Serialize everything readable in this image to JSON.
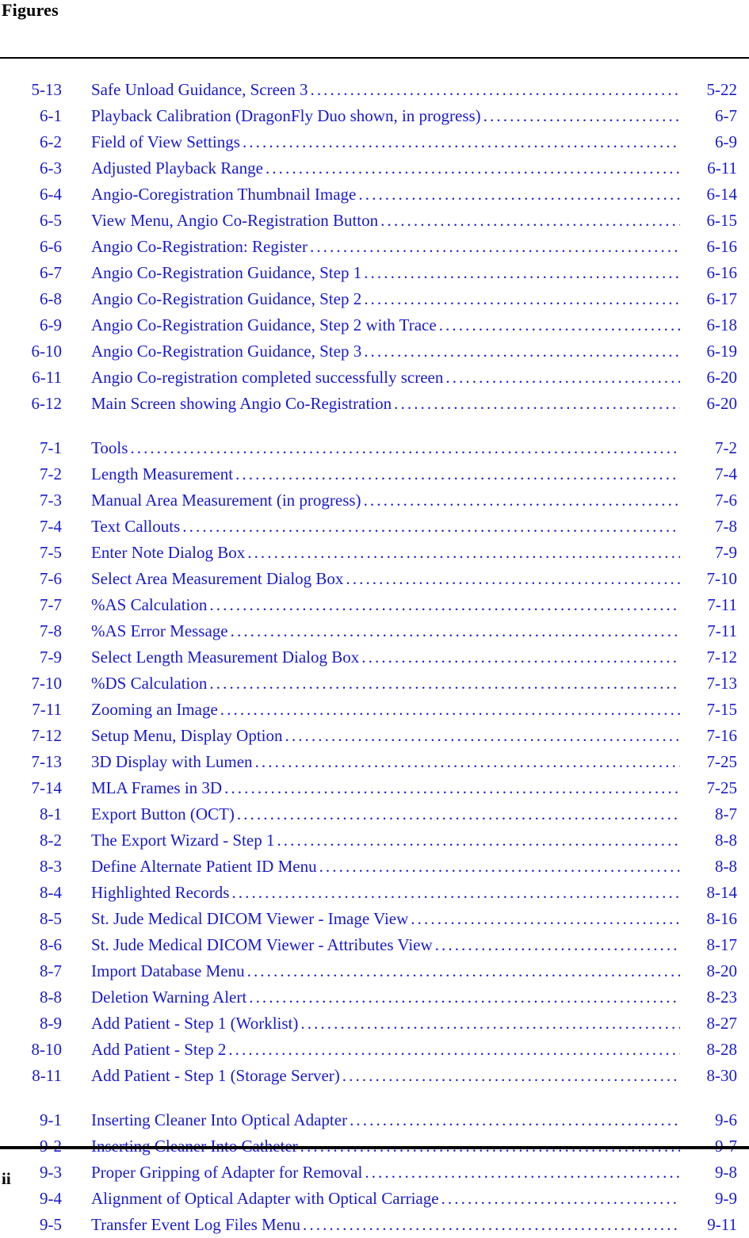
{
  "page": {
    "heading": "Figures",
    "footer_page_number": "ii",
    "text_color": "#1a1acc",
    "heading_color": "#000000",
    "leader_character": "."
  },
  "figure_groups": [
    {
      "group_id": "chapter-5-6",
      "spaced": false,
      "entries": [
        {
          "number": "5-13",
          "title": "Safe Unload Guidance, Screen 3",
          "page": "5-22"
        },
        {
          "number": "6-1",
          "title": "Playback Calibration (DragonFly Duo shown, in progress)",
          "page": "6-7"
        },
        {
          "number": "6-2",
          "title": "Field of View Settings",
          "page": "6-9"
        },
        {
          "number": "6-3",
          "title": "Adjusted Playback Range",
          "page": "6-11"
        },
        {
          "number": "6-4",
          "title": "Angio-Coregistration Thumbnail Image",
          "page": "6-14"
        },
        {
          "number": "6-5",
          "title": "View Menu, Angio Co-Registration Button",
          "page": "6-15"
        },
        {
          "number": "6-6",
          "title": "Angio Co-Registration: Register",
          "page": "6-16"
        },
        {
          "number": "6-7",
          "title": "Angio Co-Registration Guidance, Step 1",
          "page": "6-16"
        },
        {
          "number": "6-8",
          "title": "Angio Co-Registration Guidance, Step 2",
          "page": "6-17"
        },
        {
          "number": "6-9",
          "title": "Angio Co-Registration Guidance, Step 2 with Trace",
          "page": "6-18"
        },
        {
          "number": "6-10",
          "title": "Angio Co-Registration Guidance, Step 3",
          "page": "6-19"
        },
        {
          "number": "6-11",
          "title": "Angio Co-registration completed successfully screen",
          "page": "6-20"
        },
        {
          "number": "6-12",
          "title": "Main Screen showing Angio Co-Registration",
          "page": "6-20"
        }
      ]
    },
    {
      "group_id": "chapter-7-8",
      "spaced": true,
      "entries": [
        {
          "number": "7-1",
          "title": "Tools",
          "page": "7-2"
        },
        {
          "number": "7-2",
          "title": "Length Measurement",
          "page": "7-4"
        },
        {
          "number": "7-3",
          "title": "Manual Area Measurement (in progress)",
          "page": "7-6"
        },
        {
          "number": "7-4",
          "title": "Text Callouts",
          "page": "7-8"
        },
        {
          "number": "7-5",
          "title": "Enter Note Dialog Box",
          "page": "7-9"
        },
        {
          "number": "7-6",
          "title": "Select Area Measurement Dialog Box",
          "page": "7-10"
        },
        {
          "number": "7-7",
          "title": "%AS Calculation",
          "page": "7-11"
        },
        {
          "number": "7-8",
          "title": "%AS Error Message",
          "page": "7-11"
        },
        {
          "number": "7-9",
          "title": "Select Length Measurement Dialog Box",
          "page": "7-12"
        },
        {
          "number": "7-10",
          "title": "%DS Calculation",
          "page": "7-13"
        },
        {
          "number": "7-11",
          "title": "Zooming an Image",
          "page": "7-15"
        },
        {
          "number": "7-12",
          "title": "Setup Menu, Display Option",
          "page": "7-16"
        },
        {
          "number": "7-13",
          "title": "3D Display with Lumen",
          "page": "7-25"
        },
        {
          "number": "7-14",
          "title": "MLA Frames in 3D",
          "page": "7-25"
        },
        {
          "number": "8-1",
          "title": "Export Button (OCT)",
          "page": "8-7"
        },
        {
          "number": "8-2",
          "title": "The Export Wizard - Step 1",
          "page": "8-8"
        },
        {
          "number": "8-3",
          "title": "Define Alternate Patient ID Menu",
          "page": "8-8"
        },
        {
          "number": "8-4",
          "title": "Highlighted Records",
          "page": "8-14"
        },
        {
          "number": "8-5",
          "title": "St. Jude Medical DICOM Viewer - Image View",
          "page": "8-16"
        },
        {
          "number": "8-6",
          "title": "St. Jude Medical DICOM Viewer - Attributes View",
          "page": "8-17"
        },
        {
          "number": "8-7",
          "title": "Import Database Menu",
          "page": "8-20"
        },
        {
          "number": "8-8",
          "title": "Deletion Warning Alert",
          "page": "8-23"
        },
        {
          "number": "8-9",
          "title": "Add Patient - Step 1 (Worklist)",
          "page": "8-27"
        },
        {
          "number": "8-10",
          "title": "Add Patient - Step 2",
          "page": "8-28"
        },
        {
          "number": "8-11",
          "title": "Add Patient - Step 1 (Storage Server)",
          "page": "8-30"
        }
      ]
    },
    {
      "group_id": "chapter-9",
      "spaced": true,
      "entries": [
        {
          "number": "9-1",
          "title": "Inserting Cleaner Into Optical Adapter",
          "page": "9-6"
        },
        {
          "number": "9-2",
          "title": "Inserting Cleaner Into Catheter",
          "page": "9-7"
        },
        {
          "number": "9-3",
          "title": "Proper Gripping of Adapter for Removal",
          "page": "9-8"
        },
        {
          "number": "9-4",
          "title": "Alignment of Optical Adapter with Optical Carriage",
          "page": "9-9"
        },
        {
          "number": "9-5",
          "title": "Transfer Event Log Files Menu",
          "page": "9-11"
        }
      ]
    }
  ]
}
